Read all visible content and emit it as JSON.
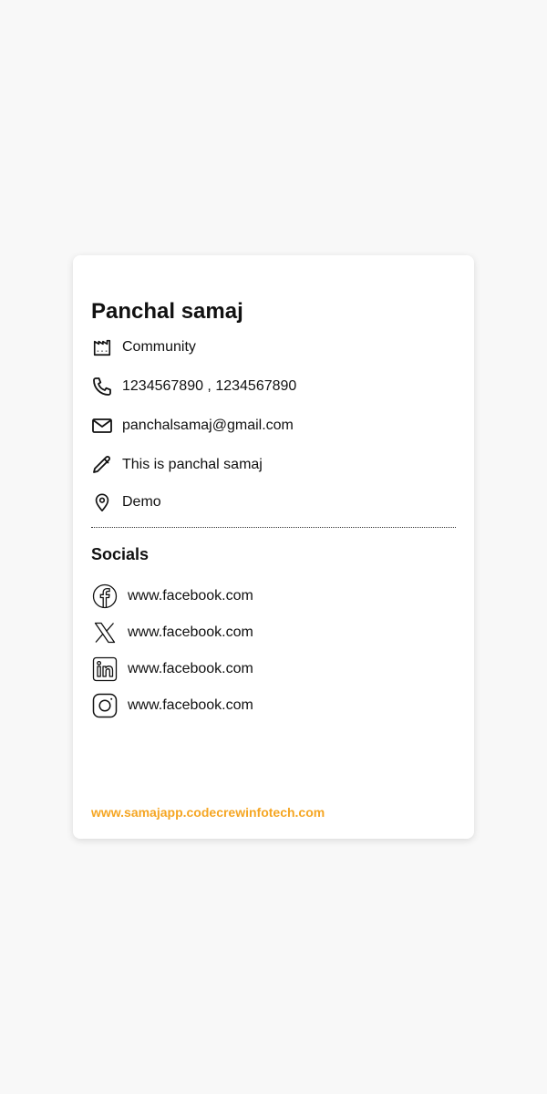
{
  "card": {
    "title": "Panchal samaj",
    "info": {
      "category": "Community",
      "phone": "1234567890 , 1234567890",
      "email": "panchalsamaj@gmail.com",
      "description": "This is panchal samaj",
      "location": "Demo"
    },
    "socials_title": "Socials",
    "socials": [
      {
        "icon": "facebook-icon",
        "text": "www.facebook.com"
      },
      {
        "icon": "x-twitter-icon",
        "text": "www.facebook.com"
      },
      {
        "icon": "linkedin-icon",
        "text": "www.facebook.com"
      },
      {
        "icon": "instagram-icon",
        "text": "www.facebook.com"
      }
    ],
    "footer_link": "www.samajapp.codecrewinfotech.com"
  },
  "colors": {
    "background": "#f8f8f8",
    "card": "#ffffff",
    "accent": "#f5a623"
  }
}
